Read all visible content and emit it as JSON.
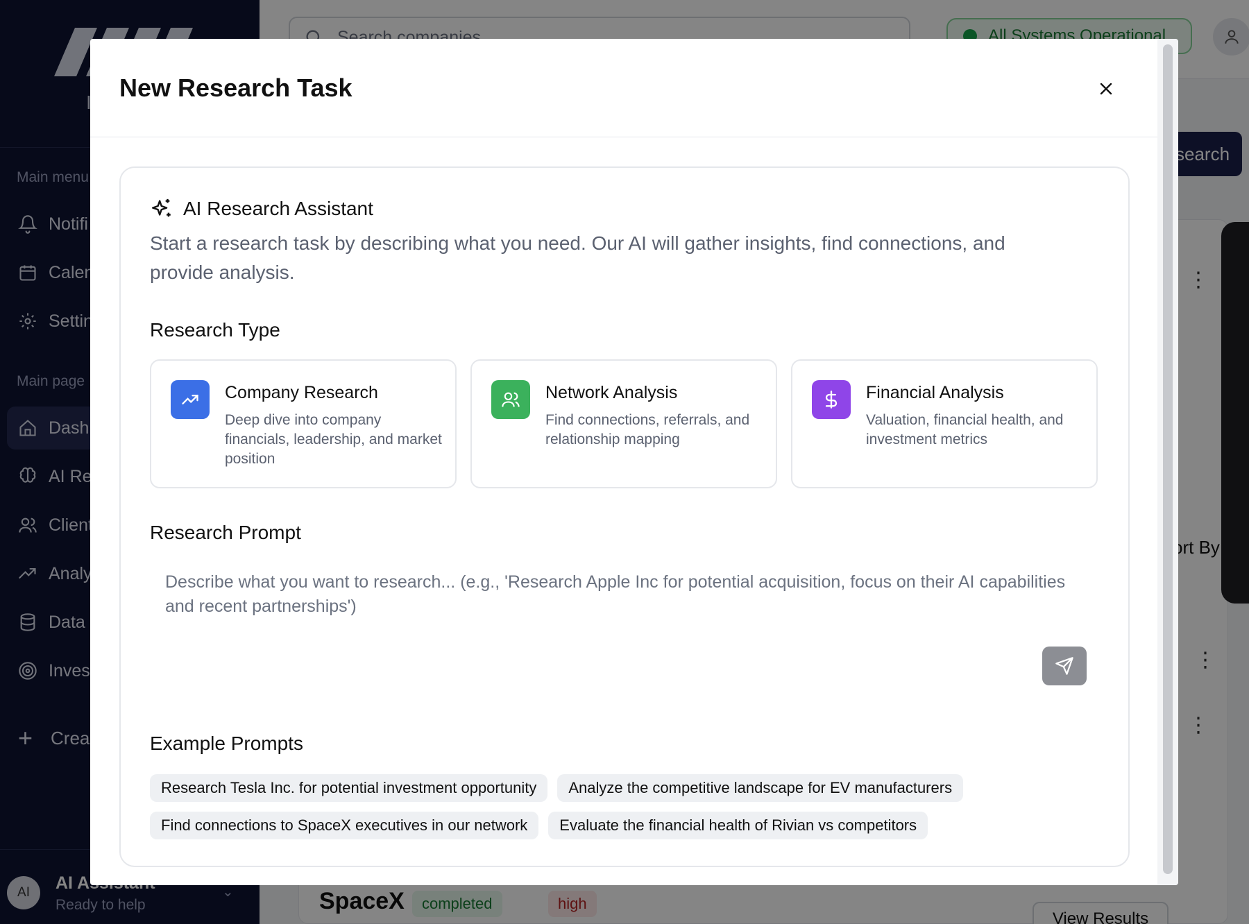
{
  "sidebar": {
    "logo_text": "I",
    "section_main_menu": "Main menu",
    "section_main_pages": "Main page",
    "menu_items": [
      {
        "label": "Notifi",
        "icon": "bell-icon"
      },
      {
        "label": "Calen",
        "icon": "calendar-icon"
      },
      {
        "label": "Settin",
        "icon": "gear-icon"
      }
    ],
    "page_items": [
      {
        "label": "Dashb",
        "icon": "home-icon"
      },
      {
        "label": "AI Res",
        "icon": "brain-icon"
      },
      {
        "label": "Client",
        "icon": "users-icon"
      },
      {
        "label": "Analy",
        "icon": "trending-up-icon"
      },
      {
        "label": "Data S",
        "icon": "database-icon"
      },
      {
        "label": "Invest",
        "icon": "target-icon"
      }
    ],
    "create_label": "Crea",
    "footer": {
      "avatar": "AI",
      "name": "AI Assistant",
      "status": "Ready to help"
    }
  },
  "topbar": {
    "search_placeholder": "Search companies",
    "status_text": "All Systems Operational"
  },
  "background": {
    "cta_label": "search",
    "sort_label": "ort By",
    "company_name": "SpaceX",
    "status_badge": "completed",
    "priority_badge": "high",
    "view_results": "View Results"
  },
  "modal": {
    "title": "New Research Task",
    "assistant": {
      "heading": "AI Research Assistant",
      "description": "Start a research task by describing what you need. Our AI will gather insights, find connections, and provide analysis."
    },
    "research_type_label": "Research Type",
    "research_types": [
      {
        "title": "Company Research",
        "description": "Deep dive into company financials, leadership, and market position",
        "icon": "trending-up-icon",
        "color": "#3b6fe6"
      },
      {
        "title": "Network Analysis",
        "description": "Find connections, referrals, and relationship mapping",
        "icon": "users-icon",
        "color": "#3bb15c"
      },
      {
        "title": "Financial Analysis",
        "description": "Valuation, financial health, and investment metrics",
        "icon": "dollar-icon",
        "color": "#8f45e8"
      }
    ],
    "prompt_label": "Research Prompt",
    "prompt_value": "",
    "prompt_placeholder": "Describe what you want to research... (e.g., 'Research Apple Inc for potential acquisition, focus on their AI capabilities and recent partnerships')",
    "examples_label": "Example Prompts",
    "examples": [
      "Research Tesla Inc. for potential investment opportunity",
      "Analyze the competitive landscape for EV manufacturers",
      "Find connections to SpaceX executives in our network",
      "Evaluate the financial health of Rivian vs competitors"
    ]
  }
}
